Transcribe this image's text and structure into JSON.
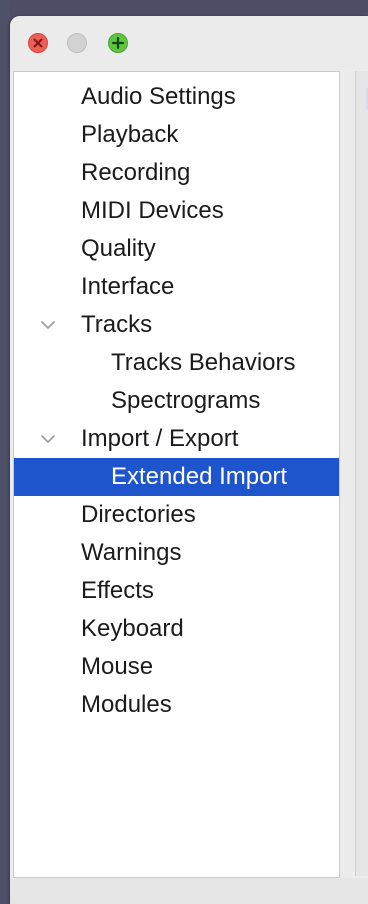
{
  "window": {
    "icons": {
      "close": "close-icon",
      "minimize": "minimize-icon",
      "zoom": "zoom-plus-icon",
      "disclosure": "chevron-down-icon"
    },
    "colors": {
      "selection": "#1f55cc",
      "close": "#ee5e57",
      "zoom": "#5fc53e"
    }
  },
  "tree": {
    "items": [
      {
        "label": "Audio Settings",
        "level": 0
      },
      {
        "label": "Playback",
        "level": 0
      },
      {
        "label": "Recording",
        "level": 0
      },
      {
        "label": "MIDI Devices",
        "level": 0
      },
      {
        "label": "Quality",
        "level": 0
      },
      {
        "label": "Interface",
        "level": 0
      },
      {
        "label": "Tracks",
        "level": 0,
        "expanded": true
      },
      {
        "label": "Tracks Behaviors",
        "level": 1
      },
      {
        "label": "Spectrograms",
        "level": 1
      },
      {
        "label": "Import / Export",
        "level": 0,
        "expanded": true
      },
      {
        "label": "Extended Import",
        "level": 1,
        "selected": true
      },
      {
        "label": "Directories",
        "level": 0
      },
      {
        "label": "Warnings",
        "level": 0
      },
      {
        "label": "Effects",
        "level": 0
      },
      {
        "label": "Keyboard",
        "level": 0
      },
      {
        "label": "Mouse",
        "level": 0
      },
      {
        "label": "Modules",
        "level": 0
      }
    ]
  }
}
